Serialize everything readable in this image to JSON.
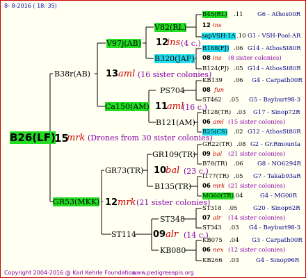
{
  "header": "8- 8-2016 ( 18: 35)",
  "footer": {
    "copyright": "Copyright 2004-2016 @ Karl Kehrle Foundation.",
    "website": "www.pedigreeapis.org"
  },
  "root": {
    "id": "B26(LF)",
    "count": "15",
    "type": "mrk",
    "note": "(Drones from 30 sister colonies)"
  },
  "gen1": [
    {
      "id": "B38r(AB)",
      "count": "13",
      "type": "aml",
      "note": "(16 sister colonies)"
    },
    {
      "id": "GR53(MKK)",
      "count": "12",
      "type": "mrk",
      "note": "(21 sister colonies)"
    }
  ],
  "gen2": [
    {
      "id": "V97j(AB)"
    },
    {
      "id": "Ca150(AM)",
      "count": "11",
      "type": "aml",
      "note": "(16 c.)"
    },
    {
      "id": "GR73(TR)",
      "count": "10",
      "type": "bal",
      "note": "(23 c.)"
    },
    {
      "id": "ST114",
      "count": "09",
      "type": "alr",
      "note": "(14 c.)"
    }
  ],
  "gen3": [
    {
      "id": "V82(RL)",
      "count": "12",
      "type": "ins",
      "note": "(4 c.)"
    },
    {
      "id": "B320(JAF)"
    },
    {
      "id": "PS704",
      "count": "08",
      "type": "fun"
    },
    {
      "id": "B121(AM)",
      "count": "06",
      "type": "aml",
      "note": "(15 sister colonies)"
    },
    {
      "id": "GR109(TR)",
      "count": "09",
      "type": "bal",
      "note": "(21 sister colonies)"
    },
    {
      "id": "B135(TR)",
      "count": "06",
      "type": "mrk",
      "note": "(21 sister colonies)"
    },
    {
      "id": "ST348",
      "count": "07",
      "type": "alr",
      "note": "(14 sister colonies)"
    },
    {
      "id": "KB080",
      "count": "06",
      "type": "nex",
      "note": "(12 sister colonies)"
    }
  ],
  "gen4": [
    {
      "id": "B45(RL)",
      "year": ".11",
      "source": "G6 - Athos00R"
    },
    {
      "id": "sapVSH-1A",
      "year": ".10",
      "source": "G1 - VSH-Pool-AR"
    },
    {
      "id": "B188(FJ)",
      "year": ".06",
      "source": "G14 - AthosSt80R"
    },
    {
      "id": "B124(PJ)",
      "year": ".05",
      "source": "G14 - AthosSt80R"
    },
    {
      "id": "KB139",
      "year": ".06",
      "source": "G4 - Carpath00R"
    },
    {
      "id": "ST462",
      "year": ".05",
      "source": "G5 - Bayburt98-3"
    },
    {
      "id": "B128(TR)",
      "year": ".03",
      "source": "G17 - Sinop72R"
    },
    {
      "id": "B25(CS)",
      "year": ".02",
      "source": "G12 - AthosSt80R"
    },
    {
      "id": "GR22(TR)",
      "year": ".08",
      "source": "G2 - Gr.Rmounta"
    },
    {
      "id": "B78(TR)",
      "year": ".06",
      "source": "G8 - NO6294R"
    },
    {
      "id": "I177(TR)",
      "year": ".05",
      "source": "G7 - Takab93aR"
    },
    {
      "id": "MG60(TR)",
      "year": ".04",
      "source": "G4 - MG00R"
    },
    {
      "id": "ST318",
      "year": ".05",
      "source": "G20 - Sinop62R"
    },
    {
      "id": "ST343",
      "year": ".03",
      "source": "G4 - Bayburt98-3"
    },
    {
      "id": "KB075",
      "year": ".04",
      "source": "G3 - Carpath00R"
    },
    {
      "id": "KB266",
      "year": ".03",
      "source": "G4 - Sinop96R"
    }
  ],
  "gen4_mid": [
    {
      "count": "08",
      "type": "ins",
      "note": "(8 sister colonies)"
    }
  ],
  "colors": {
    "highlight_green": "#22dd22",
    "highlight_cyan": "#22ddee",
    "accent_red": "#cc0000",
    "accent_purple": "#8800aa",
    "source_blue": "#000088"
  }
}
